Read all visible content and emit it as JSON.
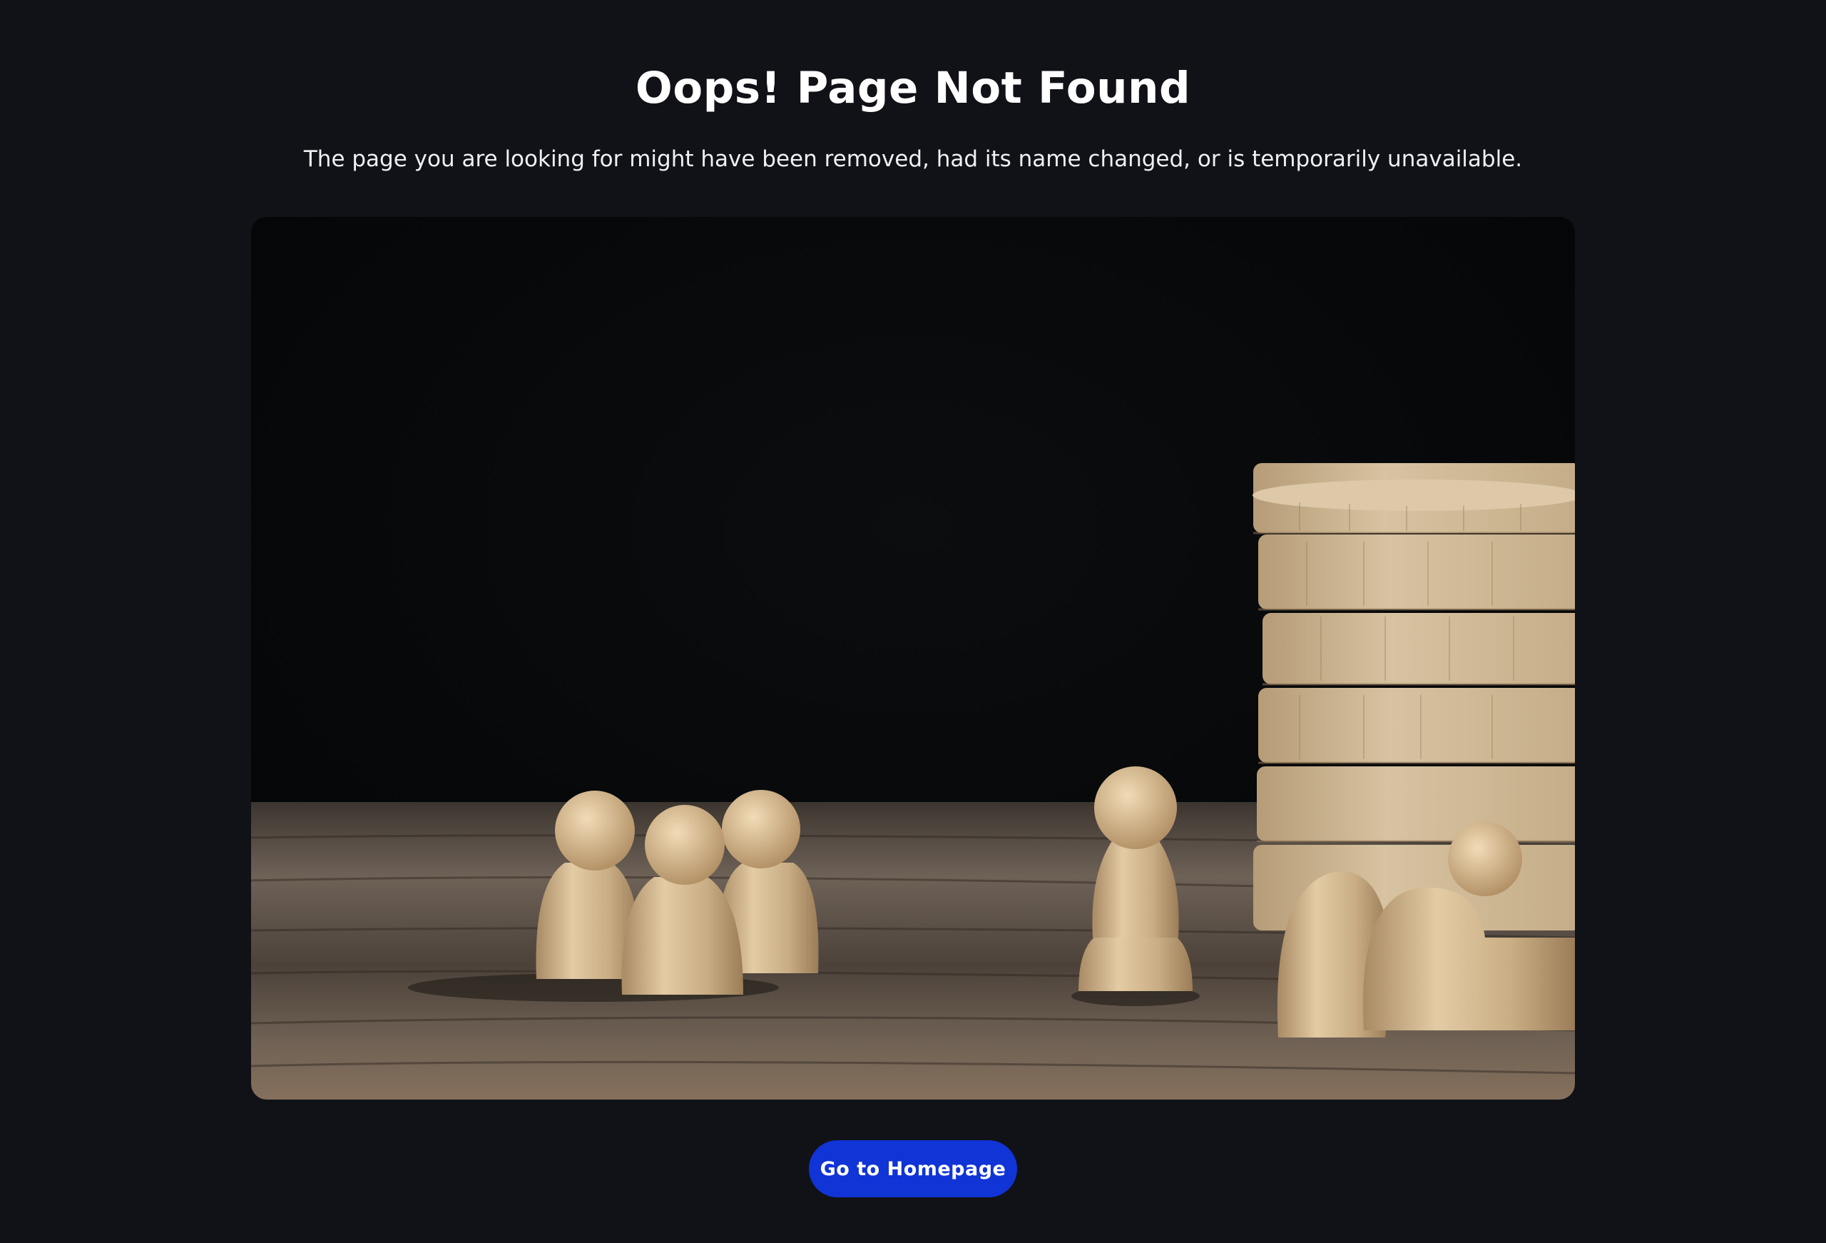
{
  "error": {
    "title": "Oops! Page Not Found",
    "message": "The page you are looking for might have been removed, had its name changed, or is temporarily unavailable."
  },
  "hero_image": {
    "subject": "wooden-game-pieces-and-coin-stack"
  },
  "actions": {
    "home_label": "Go to Homepage"
  },
  "colors": {
    "background": "#101217",
    "accent": "#1134d6",
    "text": "#ffffff"
  }
}
